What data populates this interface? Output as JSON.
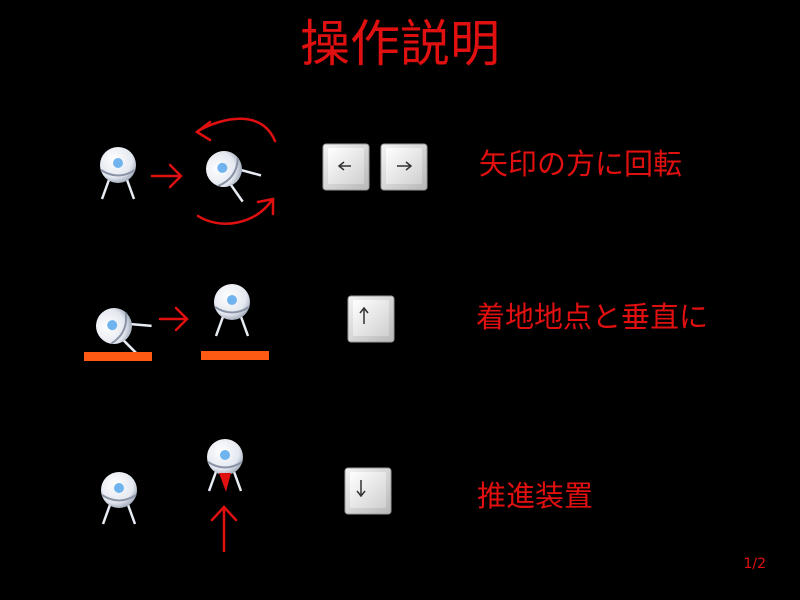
{
  "screen": {
    "title": "操作説明",
    "page_indicator": "1/2"
  },
  "instructions": [
    {
      "label": "矢印の方に回転",
      "keys": [
        "left-arrow-key",
        "right-arrow-key"
      ]
    },
    {
      "label": "着地地点と垂直に",
      "keys": [
        "up-arrow-key"
      ]
    },
    {
      "label": "推進装置",
      "keys": [
        "down-arrow-key"
      ]
    }
  ],
  "colors": {
    "background": "#000000",
    "text": "#e01010",
    "landing_pad": "#ff5a14",
    "lander_body": "#e8ecf4",
    "lander_window": "#6fb4ee",
    "key_face": "#d8d8d8",
    "thrust_flame": "#e01010"
  }
}
